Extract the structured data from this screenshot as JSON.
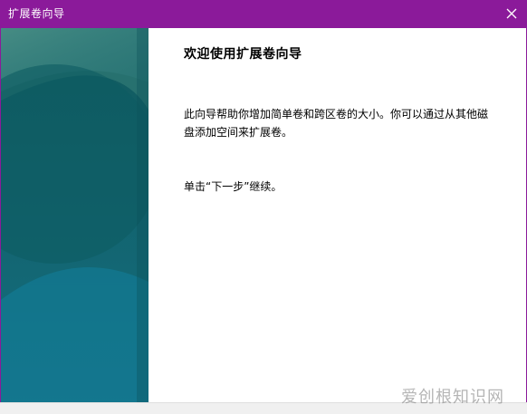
{
  "window": {
    "title": "扩展卷向导"
  },
  "content": {
    "heading": "欢迎使用扩展卷向导",
    "description": "此向导帮助你增加简单卷和跨区卷的大小。你可以通过从其他磁盘添加空间来扩展卷。",
    "next_hint": "单击“下一步”继续。"
  },
  "watermark": "爱创根知识网",
  "colors": {
    "titlebar": "#8b1a9a",
    "panel_teal": "#1f6a72"
  },
  "icons": {
    "close": "close-icon"
  }
}
